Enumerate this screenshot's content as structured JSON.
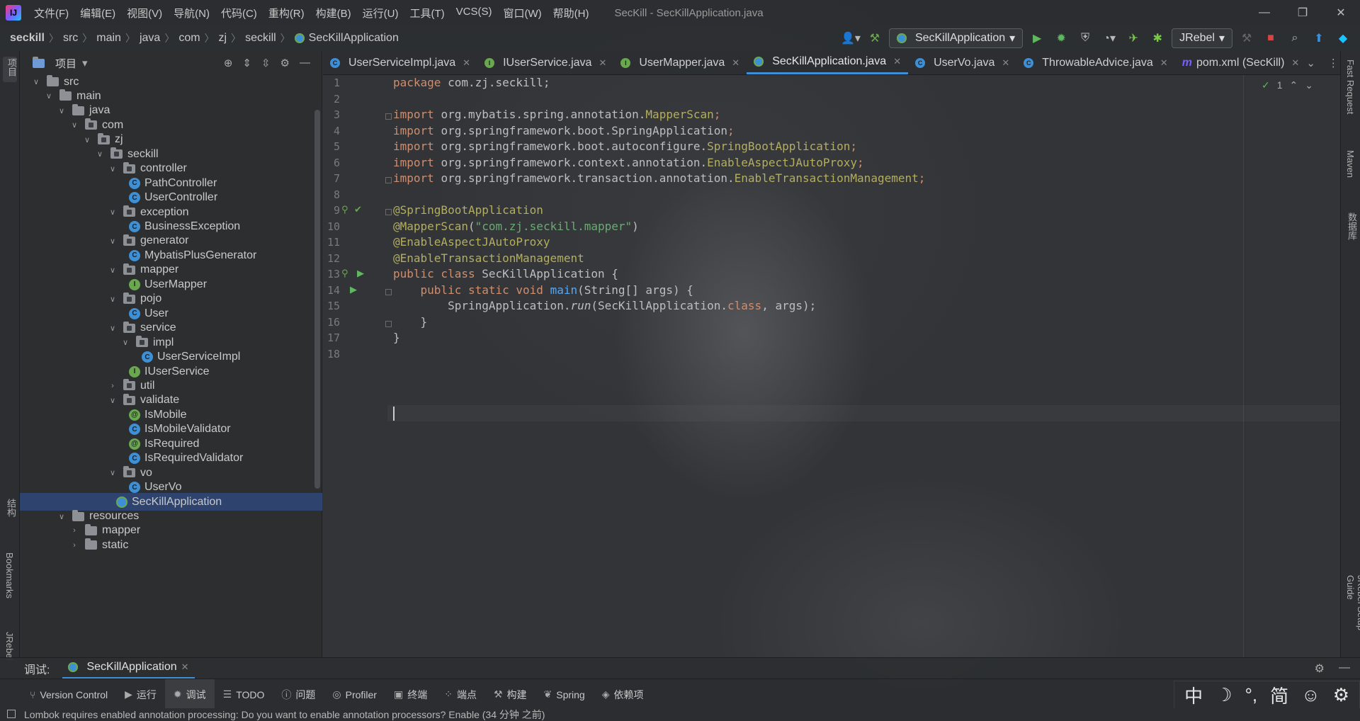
{
  "window": {
    "title": "SecKill - SecKillApplication.java",
    "menu": [
      "文件(F)",
      "编辑(E)",
      "视图(V)",
      "导航(N)",
      "代码(C)",
      "重构(R)",
      "构建(B)",
      "运行(U)",
      "工具(T)",
      "VCS(S)",
      "窗口(W)",
      "帮助(H)"
    ]
  },
  "breadcrumb": [
    "seckill",
    "src",
    "main",
    "java",
    "com",
    "zj",
    "seckill",
    "SecKillApplication"
  ],
  "run_config": {
    "name": "SecKillApplication",
    "jrebel": "JRebel"
  },
  "left_strip": {
    "project": "项目",
    "structure": "结构",
    "bookmarks": "Bookmarks",
    "jrebel": "JRebel"
  },
  "right_strip": {
    "fast_request": "Fast Request",
    "maven": "Maven",
    "database": "数据库",
    "jrebel_guide": "JRebel Setup Guide"
  },
  "project_panel": {
    "title": "项目",
    "tree": [
      {
        "label": "src",
        "kind": "folder",
        "depth": 1,
        "open": true
      },
      {
        "label": "main",
        "kind": "folder",
        "depth": 2,
        "open": true
      },
      {
        "label": "java",
        "kind": "folder",
        "depth": 3,
        "open": true
      },
      {
        "label": "com",
        "kind": "package",
        "depth": 4,
        "open": true
      },
      {
        "label": "zj",
        "kind": "package",
        "depth": 5,
        "open": true
      },
      {
        "label": "seckill",
        "kind": "package",
        "depth": 6,
        "open": true
      },
      {
        "label": "controller",
        "kind": "package",
        "depth": 7,
        "open": true
      },
      {
        "label": "PathController",
        "kind": "class",
        "depth": 8
      },
      {
        "label": "UserController",
        "kind": "class",
        "depth": 8
      },
      {
        "label": "exception",
        "kind": "package",
        "depth": 7,
        "open": true
      },
      {
        "label": "BusinessException",
        "kind": "class",
        "depth": 8
      },
      {
        "label": "generator",
        "kind": "package",
        "depth": 7,
        "open": true
      },
      {
        "label": "MybatisPlusGenerator",
        "kind": "class",
        "depth": 8
      },
      {
        "label": "mapper",
        "kind": "package",
        "depth": 7,
        "open": true
      },
      {
        "label": "UserMapper",
        "kind": "interface",
        "depth": 8
      },
      {
        "label": "pojo",
        "kind": "package",
        "depth": 7,
        "open": true
      },
      {
        "label": "User",
        "kind": "class",
        "depth": 8
      },
      {
        "label": "service",
        "kind": "package",
        "depth": 7,
        "open": true
      },
      {
        "label": "impl",
        "kind": "package",
        "depth": 8,
        "open": true
      },
      {
        "label": "UserServiceImpl",
        "kind": "class",
        "depth": 9
      },
      {
        "label": "IUserService",
        "kind": "interface",
        "depth": 8
      },
      {
        "label": "util",
        "kind": "package",
        "depth": 7,
        "open": false
      },
      {
        "label": "validate",
        "kind": "package",
        "depth": 7,
        "open": true
      },
      {
        "label": "IsMobile",
        "kind": "annotation",
        "depth": 8
      },
      {
        "label": "IsMobileValidator",
        "kind": "class",
        "depth": 8
      },
      {
        "label": "IsRequired",
        "kind": "annotation",
        "depth": 8
      },
      {
        "label": "IsRequiredValidator",
        "kind": "class",
        "depth": 8
      },
      {
        "label": "vo",
        "kind": "package",
        "depth": 7,
        "open": true
      },
      {
        "label": "UserVo",
        "kind": "class",
        "depth": 8
      },
      {
        "label": "SecKillApplication",
        "kind": "boot",
        "depth": 7,
        "selected": true
      },
      {
        "label": "resources",
        "kind": "folder",
        "depth": 3,
        "open": true
      },
      {
        "label": "mapper",
        "kind": "folder",
        "depth": 4,
        "open": false
      },
      {
        "label": "static",
        "kind": "folder",
        "depth": 4,
        "open": false
      }
    ]
  },
  "tabs": [
    {
      "label": "UserServiceImpl.java",
      "icon": "class",
      "active": false
    },
    {
      "label": "IUserService.java",
      "icon": "interface",
      "active": false
    },
    {
      "label": "UserMapper.java",
      "icon": "interface",
      "active": false
    },
    {
      "label": "SecKillApplication.java",
      "icon": "boot",
      "active": true
    },
    {
      "label": "UserVo.java",
      "icon": "class",
      "active": false
    },
    {
      "label": "ThrowableAdvice.java",
      "icon": "class",
      "active": false
    },
    {
      "label": "pom.xml (SecKill)",
      "icon": "maven",
      "active": false
    }
  ],
  "editor": {
    "inspection_count": "1",
    "lines": [
      [
        {
          "t": "package ",
          "c": "kw"
        },
        {
          "t": "com.zj.seckill;",
          "c": ""
        }
      ],
      [],
      [
        {
          "t": "import ",
          "c": "kw"
        },
        {
          "t": "org.mybatis.spring.annotation.",
          "c": ""
        },
        {
          "t": "MapperScan",
          "c": "ann"
        },
        {
          "t": ";",
          "c": "kw"
        }
      ],
      [
        {
          "t": "import ",
          "c": "kw"
        },
        {
          "t": "org.springframework.boot.SpringApplication",
          "c": ""
        },
        {
          "t": ";",
          "c": "kw"
        }
      ],
      [
        {
          "t": "import ",
          "c": "kw"
        },
        {
          "t": "org.springframework.boot.autoconfigure.",
          "c": ""
        },
        {
          "t": "SpringBootApplication",
          "c": "ann"
        },
        {
          "t": ";",
          "c": "kw"
        }
      ],
      [
        {
          "t": "import ",
          "c": "kw"
        },
        {
          "t": "org.springframework.context.annotation.",
          "c": ""
        },
        {
          "t": "EnableAspectJAutoProxy",
          "c": "ann"
        },
        {
          "t": ";",
          "c": "kw"
        }
      ],
      [
        {
          "t": "import ",
          "c": "kw"
        },
        {
          "t": "org.springframework.transaction.annotation.",
          "c": ""
        },
        {
          "t": "EnableTransactionManagement",
          "c": "ann"
        },
        {
          "t": ";",
          "c": "kw"
        }
      ],
      [],
      [
        {
          "t": "@SpringBootApplication",
          "c": "ann"
        }
      ],
      [
        {
          "t": "@MapperScan",
          "c": "ann"
        },
        {
          "t": "(",
          "c": ""
        },
        {
          "t": "\"com.zj.seckill.mapper\"",
          "c": "str"
        },
        {
          "t": ")",
          "c": ""
        }
      ],
      [
        {
          "t": "@EnableAspectJAutoProxy",
          "c": "ann"
        }
      ],
      [
        {
          "t": "@EnableTransactionManagement",
          "c": "ann"
        }
      ],
      [
        {
          "t": "public class ",
          "c": "kw"
        },
        {
          "t": "SecKillApplication {",
          "c": ""
        }
      ],
      [
        {
          "t": "    public static void ",
          "c": "kw"
        },
        {
          "t": "main",
          "c": "fn"
        },
        {
          "t": "(String[] args) {",
          "c": ""
        }
      ],
      [
        {
          "t": "        SpringApplication.",
          "c": ""
        },
        {
          "t": "run",
          "c": "italic"
        },
        {
          "t": "(SecKillApplication.",
          "c": ""
        },
        {
          "t": "class",
          "c": "kw"
        },
        {
          "t": ", args);",
          "c": ""
        }
      ],
      [
        {
          "t": "    }",
          "c": ""
        }
      ],
      [
        {
          "t": "}",
          "c": ""
        }
      ],
      []
    ]
  },
  "debug": {
    "label": "调试:",
    "session": "SecKillApplication"
  },
  "bottom_tools": [
    "Version Control",
    "运行",
    "调试",
    "TODO",
    "问题",
    "Profiler",
    "终端",
    "端点",
    "构建",
    "Spring",
    "依赖项"
  ],
  "ime": [
    "中",
    "☽",
    "°,",
    "简",
    "☺",
    "⚙"
  ],
  "status": {
    "message": "Lombok requires enabled annotation processing: Do you want to enable annotation processors? Enable (34 分钟 之前)"
  }
}
